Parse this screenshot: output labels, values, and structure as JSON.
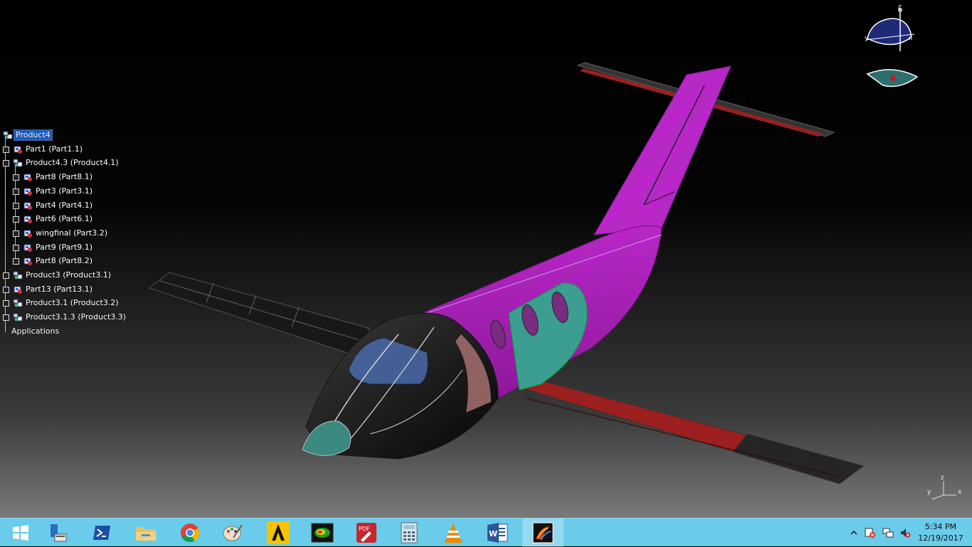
{
  "tree": {
    "items": [
      {
        "label": "Product4",
        "level": 0,
        "selected": true
      },
      {
        "label": "Part1 (Part1.1)",
        "level": 1
      },
      {
        "label": "Product4.3 (Product4.1)",
        "level": 1
      },
      {
        "label": "Part8 (Part8.1)",
        "level": 2
      },
      {
        "label": "Part3 (Part3.1)",
        "level": 2
      },
      {
        "label": "Part4 (Part4.1)",
        "level": 2
      },
      {
        "label": "Part6 (Part6.1)",
        "level": 2
      },
      {
        "label": "wingfinal (Part3.2)",
        "level": 2
      },
      {
        "label": "Part9 (Part9.1)",
        "level": 2
      },
      {
        "label": "Part8 (Part8.2)",
        "level": 2
      },
      {
        "label": "Product3 (Product3.1)",
        "level": 1
      },
      {
        "label": "Part13 (Part13.1)",
        "level": 1
      },
      {
        "label": "Product3.1 (Product3.2)",
        "level": 1
      },
      {
        "label": "Product3.1.3 (Product3.3)",
        "level": 1
      },
      {
        "label": "Applications",
        "level": 0
      }
    ]
  },
  "compass": {
    "x_label": "x",
    "y_label": "y",
    "z_label": "z"
  },
  "mini_axis": {
    "x_label": "x",
    "y_label": "y",
    "z_label": "z"
  },
  "taskbar": {
    "apps": [
      {
        "name": "start-icon"
      },
      {
        "name": "server-manager-icon"
      },
      {
        "name": "powershell-icon"
      },
      {
        "name": "file-explorer-icon"
      },
      {
        "name": "chrome-icon"
      },
      {
        "name": "paint-icon"
      },
      {
        "name": "ansys-icon"
      },
      {
        "name": "analysis-app-icon"
      },
      {
        "name": "pdf-editor-icon"
      },
      {
        "name": "calculator-icon"
      },
      {
        "name": "vlc-icon"
      },
      {
        "name": "word-icon"
      },
      {
        "name": "catia-icon",
        "active": true
      }
    ],
    "tray": {
      "show_hidden_icon": "chevron-up-icon",
      "icons": [
        "action-center-warning-icon",
        "network-icon",
        "volume-muted-icon"
      ]
    },
    "time": "5:34 PM",
    "date": "12/19/2017"
  },
  "colors": {
    "fuselage_magenta": "#b81fc8",
    "wing_red": "#b41a1a",
    "taskbar": "#6acbea",
    "selection": "#1a5fc8"
  }
}
